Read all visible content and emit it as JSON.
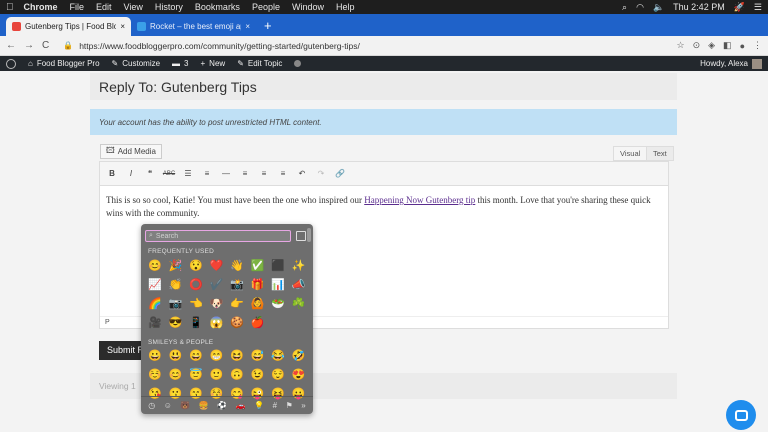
{
  "menubar": {
    "apple": "",
    "items": [
      "Chrome",
      "File",
      "Edit",
      "View",
      "History",
      "Bookmarks",
      "People",
      "Window",
      "Help"
    ],
    "clock": "Thu 2:42 PM"
  },
  "tabs": [
    {
      "title": "Gutenberg Tips | Food Blogger",
      "close": "×",
      "color": "#e8453c"
    },
    {
      "title": "Rocket – the best emoji app fo",
      "close": "×",
      "color": "#3aa0e8"
    }
  ],
  "newtab": "+",
  "toolbar": {
    "url": "https://www.foodbloggerpro.com/community/getting-started/gutenberg-tips/",
    "back": "←",
    "forward": "→",
    "reload": "C"
  },
  "wpbar": {
    "site": "Food Blogger Pro",
    "customize": "Customize",
    "comments": "3",
    "new": "New",
    "edit_topic": "Edit Topic",
    "howdy": "Howdy, Alexa"
  },
  "page": {
    "title": "Reply To: Gutenberg Tips",
    "notice": "Your account has the ability to post unrestricted HTML content.",
    "add_media": "Add Media",
    "tab_visual": "Visual",
    "tab_text": "Text",
    "content_before": "This is so so cool, Katie! You must have been the one who inspired our ",
    "content_link": "Happening Now Gutenberg tip",
    "content_after": " this month. Love that you're sharing these quick wins with the community.",
    "path": "P",
    "submit": "Submit R",
    "viewing": "Viewing 1"
  },
  "format_buttons": [
    "B",
    "I",
    "❝",
    "ABC",
    "☰",
    "≡",
    "—",
    "≡",
    "≡",
    "≡",
    "↶",
    "↷",
    "🔗"
  ],
  "picker": {
    "search_placeholder": "Search",
    "frequently_used_label": "FREQUENTLY USED",
    "frequently_used": [
      [
        "😊",
        "🎉",
        "😯",
        "❤️",
        "👋",
        "✅",
        "⬛",
        "✨"
      ],
      [
        "📈",
        "👏",
        "⭕",
        "✔️",
        "📸",
        "🎁",
        "📊",
        "📣"
      ],
      [
        "🌈",
        "📷",
        "👈",
        "🐶",
        "👉",
        "🙆",
        "🥗",
        "☘️"
      ],
      [
        "🎥",
        "😎",
        "📱",
        "😱",
        "🍪",
        "🍎"
      ]
    ],
    "smileys_label": "SMILEYS & PEOPLE",
    "smileys": [
      [
        "😀",
        "😃",
        "😄",
        "😁",
        "😆",
        "😅",
        "😂",
        "🤣"
      ],
      [
        "☺️",
        "😊",
        "😇",
        "🙂",
        "🙃",
        "😉",
        "😌",
        "😍"
      ],
      [
        "😘",
        "😗",
        "😙",
        "😚",
        "😋",
        "😜",
        "😝",
        "😛"
      ]
    ],
    "categories": [
      "◷",
      "☺",
      "🐻",
      "🍔",
      "⚽",
      "🚗",
      "💡",
      "#",
      "⚑",
      "»"
    ]
  }
}
